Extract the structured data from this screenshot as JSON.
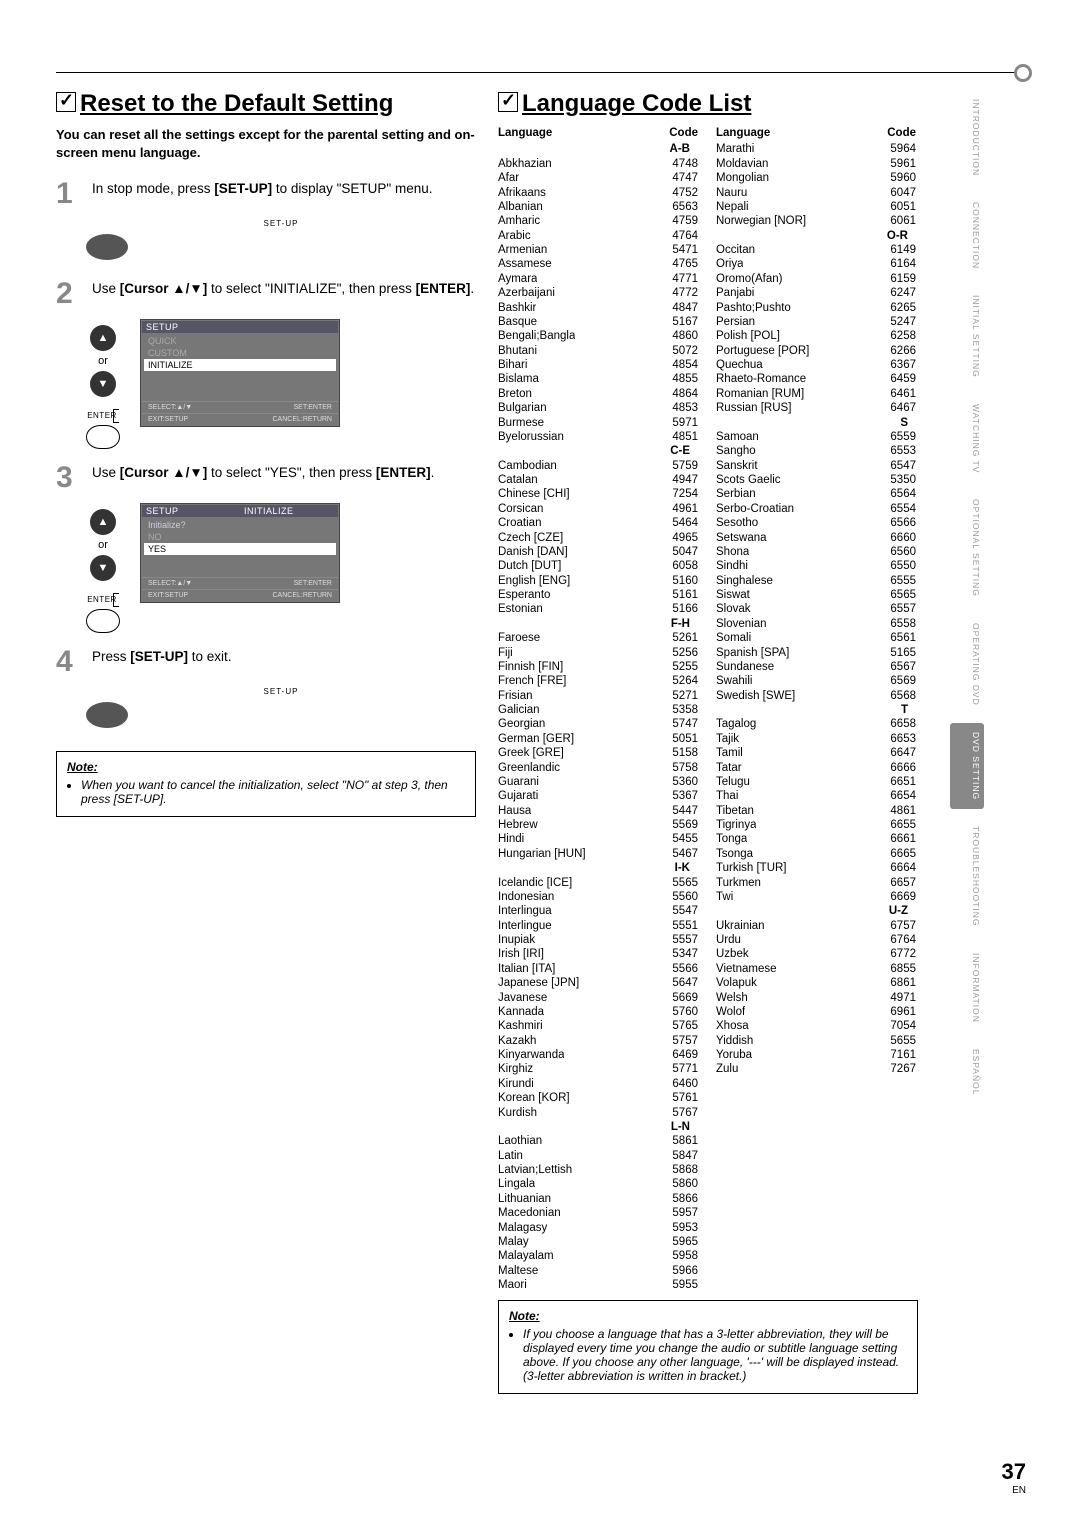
{
  "page": {
    "number": "37",
    "lang_abbr": "EN"
  },
  "sidebar": {
    "tabs": [
      {
        "label": "INTRODUCTION",
        "active": false
      },
      {
        "label": "CONNECTION",
        "active": false
      },
      {
        "label": "INITIAL SETTING",
        "active": false
      },
      {
        "label": "WATCHING TV",
        "active": false
      },
      {
        "label": "OPTIONAL SETTING",
        "active": false
      },
      {
        "label": "OPERATING DVD",
        "active": false
      },
      {
        "label": "DVD SETTING",
        "active": true
      },
      {
        "label": "TROUBLESHOOTING",
        "active": false
      },
      {
        "label": "INFORMATION",
        "active": false
      },
      {
        "label": "ESPAÑOL",
        "active": false
      }
    ]
  },
  "left": {
    "title": "Reset to the Default Setting",
    "intro": "You can reset all the settings except for the parental setting and on-screen menu language.",
    "steps": [
      {
        "n": "1",
        "text_pre": "In stop mode, press ",
        "bold1": "[SET-UP]",
        "text_post": " to display \"SETUP\" menu.",
        "illust": "setup"
      },
      {
        "n": "2",
        "text_pre": "Use ",
        "bold1": "[Cursor ▲/▼]",
        "text_mid": " to select \"INITIALIZE\", then press ",
        "bold2": "[ENTER]",
        "text_post": ".",
        "illust": "osd1"
      },
      {
        "n": "3",
        "text_pre": "Use ",
        "bold1": "[Cursor ▲/▼]",
        "text_mid": " to select \"YES\", then press ",
        "bold2": "[ENTER]",
        "text_post": ".",
        "illust": "osd2"
      },
      {
        "n": "4",
        "text_pre": "Press ",
        "bold1": "[SET-UP]",
        "text_post": " to exit.",
        "illust": "setup"
      }
    ],
    "remote": {
      "setup_label": "SET-UP",
      "or": "or",
      "enter_label": "ENTER"
    },
    "osd1": {
      "tab": "SETUP",
      "items": [
        "QUICK",
        "CUSTOM",
        "INITIALIZE"
      ],
      "selected_index": 2,
      "foot_l1": "SELECT:▲/▼",
      "foot_r1": "SET:ENTER",
      "foot_l2": "EXIT:SETUP",
      "foot_r2": "CANCEL:RETURN"
    },
    "osd2": {
      "tab1": "SETUP",
      "tab2": "INITIALIZE",
      "prompt": "Initialize?",
      "items": [
        "NO",
        "YES"
      ],
      "selected_index": 1,
      "foot_l1": "SELECT:▲/▼",
      "foot_r1": "SET:ENTER",
      "foot_l2": "EXIT:SETUP",
      "foot_r2": "CANCEL:RETURN"
    },
    "note": {
      "hdr": "Note:",
      "body": "When you want to cancel the initialization, select \"NO\" at step 3, then press [SET-UP]."
    }
  },
  "right": {
    "title": "Language Code List",
    "head_lang": "Language",
    "head_code": "Code",
    "col1": [
      {
        "section": "A-B"
      },
      {
        "l": "Abkhazian",
        "c": "4748"
      },
      {
        "l": "Afar",
        "c": "4747"
      },
      {
        "l": "Afrikaans",
        "c": "4752"
      },
      {
        "l": "Albanian",
        "c": "6563"
      },
      {
        "l": "Amharic",
        "c": "4759"
      },
      {
        "l": "Arabic",
        "c": "4764"
      },
      {
        "l": "Armenian",
        "c": "5471"
      },
      {
        "l": "Assamese",
        "c": "4765"
      },
      {
        "l": "Aymara",
        "c": "4771"
      },
      {
        "l": "Azerbaijani",
        "c": "4772"
      },
      {
        "l": "Bashkir",
        "c": "4847"
      },
      {
        "l": "Basque",
        "c": "5167"
      },
      {
        "l": "Bengali;Bangla",
        "c": "4860"
      },
      {
        "l": "Bhutani",
        "c": "5072"
      },
      {
        "l": "Bihari",
        "c": "4854"
      },
      {
        "l": "Bislama",
        "c": "4855"
      },
      {
        "l": "Breton",
        "c": "4864"
      },
      {
        "l": "Bulgarian",
        "c": "4853"
      },
      {
        "l": "Burmese",
        "c": "5971"
      },
      {
        "l": "Byelorussian",
        "c": "4851"
      },
      {
        "section": "C-E"
      },
      {
        "l": "Cambodian",
        "c": "5759"
      },
      {
        "l": "Catalan",
        "c": "4947"
      },
      {
        "l": "Chinese [CHI]",
        "c": "7254"
      },
      {
        "l": "Corsican",
        "c": "4961"
      },
      {
        "l": "Croatian",
        "c": "5464"
      },
      {
        "l": "Czech [CZE]",
        "c": "4965"
      },
      {
        "l": "Danish [DAN]",
        "c": "5047"
      },
      {
        "l": "Dutch [DUT]",
        "c": "6058"
      },
      {
        "l": "English [ENG]",
        "c": "5160"
      },
      {
        "l": "Esperanto",
        "c": "5161"
      },
      {
        "l": "Estonian",
        "c": "5166"
      },
      {
        "section": "F-H"
      },
      {
        "l": "Faroese",
        "c": "5261"
      },
      {
        "l": "Fiji",
        "c": "5256"
      },
      {
        "l": "Finnish [FIN]",
        "c": "5255"
      },
      {
        "l": "French [FRE]",
        "c": "5264"
      },
      {
        "l": "Frisian",
        "c": "5271"
      },
      {
        "l": "Galician",
        "c": "5358"
      },
      {
        "l": "Georgian",
        "c": "5747"
      },
      {
        "l": "German [GER]",
        "c": "5051"
      },
      {
        "l": "Greek [GRE]",
        "c": "5158"
      },
      {
        "l": "Greenlandic",
        "c": "5758"
      },
      {
        "l": "Guarani",
        "c": "5360"
      },
      {
        "l": "Gujarati",
        "c": "5367"
      },
      {
        "l": "Hausa",
        "c": "5447"
      },
      {
        "l": "Hebrew",
        "c": "5569"
      },
      {
        "l": "Hindi",
        "c": "5455"
      },
      {
        "l": "Hungarian [HUN]",
        "c": "5467"
      },
      {
        "section": "I-K"
      },
      {
        "l": "Icelandic [ICE]",
        "c": "5565"
      },
      {
        "l": "Indonesian",
        "c": "5560"
      },
      {
        "l": "Interlingua",
        "c": "5547"
      },
      {
        "l": "Interlingue",
        "c": "5551"
      },
      {
        "l": "Inupiak",
        "c": "5557"
      },
      {
        "l": "Irish [IRI]",
        "c": "5347"
      },
      {
        "l": "Italian [ITA]",
        "c": "5566"
      },
      {
        "l": "Japanese [JPN]",
        "c": "5647"
      },
      {
        "l": "Javanese",
        "c": "5669"
      },
      {
        "l": "Kannada",
        "c": "5760"
      },
      {
        "l": "Kashmiri",
        "c": "5765"
      },
      {
        "l": "Kazakh",
        "c": "5757"
      },
      {
        "l": "Kinyarwanda",
        "c": "6469"
      },
      {
        "l": "Kirghiz",
        "c": "5771"
      },
      {
        "l": "Kirundi",
        "c": "6460"
      },
      {
        "l": "Korean [KOR]",
        "c": "5761"
      },
      {
        "l": "Kurdish",
        "c": "5767"
      },
      {
        "section": "L-N"
      },
      {
        "l": "Laothian",
        "c": "5861"
      },
      {
        "l": "Latin",
        "c": "5847"
      },
      {
        "l": "Latvian;Lettish",
        "c": "5868"
      },
      {
        "l": "Lingala",
        "c": "5860"
      },
      {
        "l": "Lithuanian",
        "c": "5866"
      },
      {
        "l": "Macedonian",
        "c": "5957"
      },
      {
        "l": "Malagasy",
        "c": "5953"
      },
      {
        "l": "Malay",
        "c": "5965"
      },
      {
        "l": "Malayalam",
        "c": "5958"
      },
      {
        "l": "Maltese",
        "c": "5966"
      },
      {
        "l": "Maori",
        "c": "5955"
      }
    ],
    "col2": [
      {
        "l": "Marathi",
        "c": "5964"
      },
      {
        "l": "Moldavian",
        "c": "5961"
      },
      {
        "l": "Mongolian",
        "c": "5960"
      },
      {
        "l": "Nauru",
        "c": "6047"
      },
      {
        "l": "Nepali",
        "c": "6051"
      },
      {
        "l": "Norwegian [NOR]",
        "c": "6061"
      },
      {
        "section": "O-R"
      },
      {
        "l": "Occitan",
        "c": "6149"
      },
      {
        "l": "Oriya",
        "c": "6164"
      },
      {
        "l": "Oromo(Afan)",
        "c": "6159"
      },
      {
        "l": "Panjabi",
        "c": "6247"
      },
      {
        "l": "Pashto;Pushto",
        "c": "6265"
      },
      {
        "l": "Persian",
        "c": "5247"
      },
      {
        "l": "Polish [POL]",
        "c": "6258"
      },
      {
        "l": "Portuguese [POR]",
        "c": "6266"
      },
      {
        "l": "Quechua",
        "c": "6367"
      },
      {
        "l": "Rhaeto-Romance",
        "c": "6459"
      },
      {
        "l": "Romanian [RUM]",
        "c": "6461"
      },
      {
        "l": "Russian [RUS]",
        "c": "6467"
      },
      {
        "section": "S"
      },
      {
        "l": "Samoan",
        "c": "6559"
      },
      {
        "l": "Sangho",
        "c": "6553"
      },
      {
        "l": "Sanskrit",
        "c": "6547"
      },
      {
        "l": "Scots Gaelic",
        "c": "5350"
      },
      {
        "l": "Serbian",
        "c": "6564"
      },
      {
        "l": "Serbo-Croatian",
        "c": "6554"
      },
      {
        "l": "Sesotho",
        "c": "6566"
      },
      {
        "l": "Setswana",
        "c": "6660"
      },
      {
        "l": "Shona",
        "c": "6560"
      },
      {
        "l": "Sindhi",
        "c": "6550"
      },
      {
        "l": "Singhalese",
        "c": "6555"
      },
      {
        "l": "Siswat",
        "c": "6565"
      },
      {
        "l": "Slovak",
        "c": "6557"
      },
      {
        "l": "Slovenian",
        "c": "6558"
      },
      {
        "l": "Somali",
        "c": "6561"
      },
      {
        "l": "Spanish [SPA]",
        "c": "5165"
      },
      {
        "l": "Sundanese",
        "c": "6567"
      },
      {
        "l": "Swahili",
        "c": "6569"
      },
      {
        "l": "Swedish [SWE]",
        "c": "6568"
      },
      {
        "section": "T"
      },
      {
        "l": "Tagalog",
        "c": "6658"
      },
      {
        "l": "Tajik",
        "c": "6653"
      },
      {
        "l": "Tamil",
        "c": "6647"
      },
      {
        "l": "Tatar",
        "c": "6666"
      },
      {
        "l": "Telugu",
        "c": "6651"
      },
      {
        "l": "Thai",
        "c": "6654"
      },
      {
        "l": "Tibetan",
        "c": "4861"
      },
      {
        "l": "Tigrinya",
        "c": "6655"
      },
      {
        "l": "Tonga",
        "c": "6661"
      },
      {
        "l": "Tsonga",
        "c": "6665"
      },
      {
        "l": "Turkish [TUR]",
        "c": "6664"
      },
      {
        "l": "Turkmen",
        "c": "6657"
      },
      {
        "l": "Twi",
        "c": "6669"
      },
      {
        "section": "U-Z"
      },
      {
        "l": "Ukrainian",
        "c": "6757"
      },
      {
        "l": "Urdu",
        "c": "6764"
      },
      {
        "l": "Uzbek",
        "c": "6772"
      },
      {
        "l": "Vietnamese",
        "c": "6855"
      },
      {
        "l": "Volapuk",
        "c": "6861"
      },
      {
        "l": "Welsh",
        "c": "4971"
      },
      {
        "l": "Wolof",
        "c": "6961"
      },
      {
        "l": "Xhosa",
        "c": "7054"
      },
      {
        "l": "Yiddish",
        "c": "5655"
      },
      {
        "l": "Yoruba",
        "c": "7161"
      },
      {
        "l": "Zulu",
        "c": "7267"
      }
    ],
    "note": {
      "hdr": "Note:",
      "body": "If you choose a language that has a 3-letter abbreviation, they will be displayed every time you change the audio or subtitle language setting above. If you choose any other language, '---' will be displayed instead. (3-letter abbreviation is written in bracket.)"
    }
  }
}
